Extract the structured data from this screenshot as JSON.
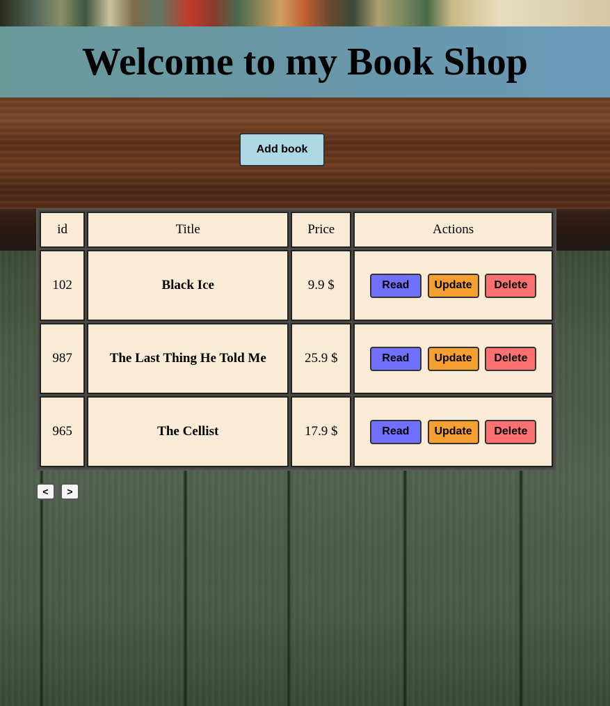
{
  "header": {
    "title": "Welcome to my Book Shop"
  },
  "toolbar": {
    "add_label": "Add book"
  },
  "table": {
    "headers": {
      "id": "id",
      "title": "Title",
      "price": "Price",
      "actions": "Actions"
    },
    "rows": [
      {
        "id": "102",
        "title": "Black Ice",
        "price": "9.9 $"
      },
      {
        "id": "987",
        "title": "The Last Thing He Told Me",
        "price": "25.9 $"
      },
      {
        "id": "965",
        "title": "The Cellist",
        "price": "17.9 $"
      }
    ],
    "actions": {
      "read": "Read",
      "update": "Update",
      "delete": "Delete"
    }
  },
  "pagination": {
    "prev": "<",
    "next": ">"
  },
  "colors": {
    "header_bg": "#6898a8",
    "add_button": "#add8e6",
    "row_bg": "#faebd7",
    "read": "#7070ff",
    "update": "#f5a030",
    "delete": "#ff7070"
  }
}
